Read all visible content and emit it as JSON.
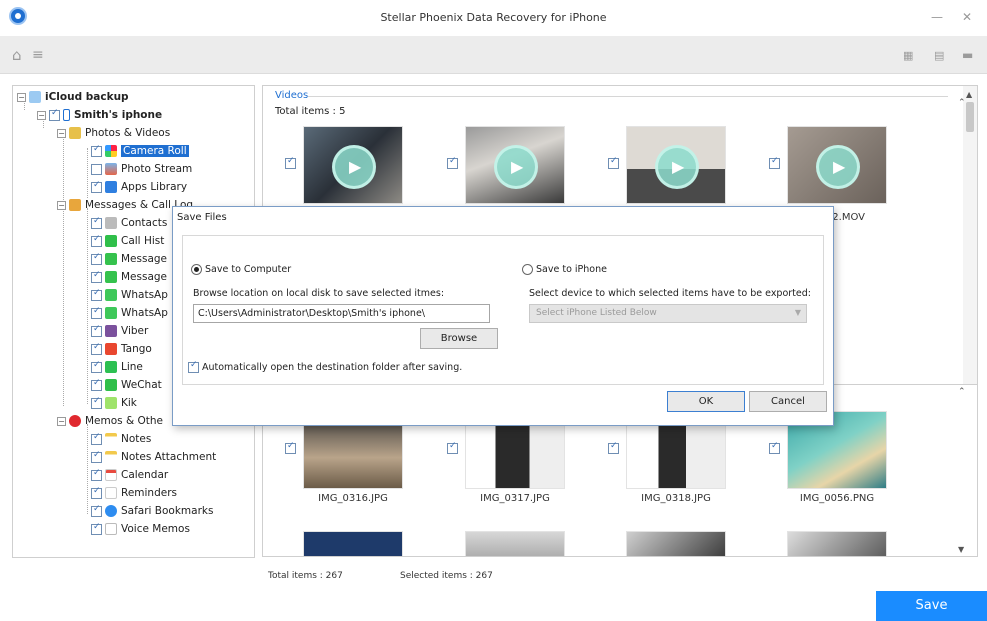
{
  "window": {
    "title": "Stellar Phoenix Data Recovery for iPhone",
    "minimize": "—",
    "close": "✕"
  },
  "toolbar": {
    "home_icon": "⌂",
    "menu_icon": "≡",
    "view_icons": [
      "▦",
      "▤",
      "▬"
    ]
  },
  "tree": {
    "root": "iCloud backup",
    "device": "Smith's iphone",
    "groups": [
      {
        "label": "Photos & Videos",
        "items": [
          "Camera Roll",
          "Photo Stream",
          "Apps Library"
        ]
      },
      {
        "label": "Messages & Call Log",
        "items": [
          "Contacts",
          "Call Hist",
          "Message",
          "Message",
          "WhatsAp",
          "WhatsAp",
          "Viber",
          "Tango",
          "Line",
          "WeChat",
          "Kik"
        ]
      },
      {
        "label": "Memos & Othe",
        "items": [
          "Notes",
          "Notes Attachment",
          "Calendar",
          "Reminders",
          "Safari Bookmarks",
          "Voice Memos"
        ]
      }
    ]
  },
  "videos_panel": {
    "title": "Videos",
    "total": "Total items : 5",
    "captions": [
      "",
      "",
      "",
      "2.MOV"
    ]
  },
  "photos_panel": {
    "captions": [
      "IMG_0316.JPG",
      "IMG_0317.JPG",
      "IMG_0318.JPG",
      "IMG_0056.PNG"
    ]
  },
  "status": {
    "total": "Total items : 267",
    "selected": "Selected items : 267"
  },
  "save_button": "Save",
  "dialog": {
    "title": "Save Files",
    "option_computer": "Save to Computer",
    "option_iphone": "Save to iPhone",
    "browse_label": "Browse location on local disk to save selected itmes:",
    "path_value": "C:\\Users\\Administrator\\Desktop\\Smith's iphone\\",
    "browse_button": "Browse",
    "device_label": "Select device to which selected items have to be exported:",
    "device_placeholder": "Select iPhone Listed Below",
    "auto_open": "Automatically open the destination folder after saving.",
    "ok": "OK",
    "cancel": "Cancel"
  },
  "colors": {
    "accent": "#1f6fd1",
    "save_button": "#1a8cff"
  }
}
